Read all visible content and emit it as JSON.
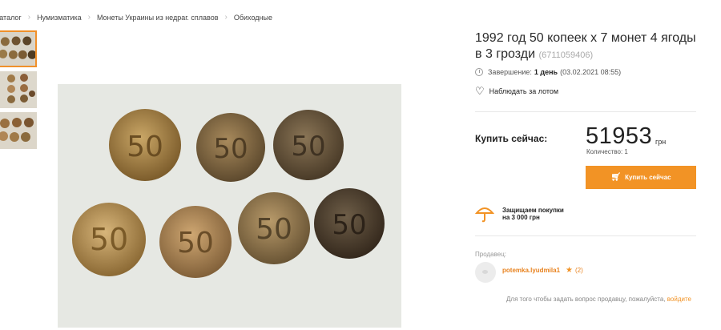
{
  "breadcrumb": {
    "items": [
      "Каталог",
      "Нумизматика",
      "Монеты Украины из недраг. сплавов",
      "Обиходные"
    ],
    "separator": "›"
  },
  "lot": {
    "title": "1992 год 50 копеек х 7 монет 4 ягоды в 3 грозди",
    "id": "(6711059406)",
    "ends_label": "Завершение:",
    "ends_value": "1 день",
    "ends_date": "(03.02.2021 08:55)",
    "watch_label": "Наблюдать за лотом"
  },
  "buy": {
    "label": "Купить сейчас:",
    "price": "51953",
    "currency": "грн",
    "quantity": "Количество: 1",
    "button_label": "Купить сейчас"
  },
  "protection": {
    "text": "Защищаем покупки\nна 3 000 грн"
  },
  "seller": {
    "label": "Продавец:",
    "name": "potemka.lyudmila1",
    "rating": "(2)"
  },
  "question": {
    "text": "Для того чтобы задать вопрос продавцу, пожалуйста,",
    "link": "войдите"
  },
  "colors": {
    "accent": "#f29325",
    "seller_link": "#e8821e"
  },
  "icons": [
    "clock-icon",
    "heart-icon",
    "cart-icon",
    "umbrella-icon",
    "star-icon"
  ],
  "photos": {
    "count": 3,
    "active_index": 0
  }
}
